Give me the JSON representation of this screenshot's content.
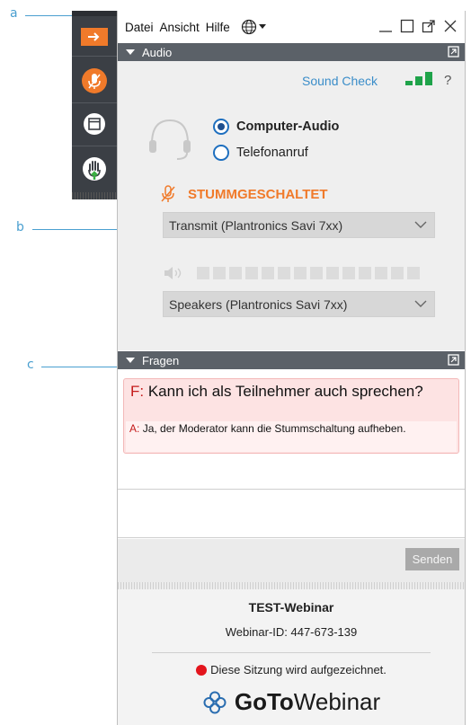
{
  "callouts": [
    "a",
    "b",
    "c"
  ],
  "toolbar": {
    "buttons": [
      {
        "name": "arrow-right-icon",
        "color": "#f07a2a"
      },
      {
        "name": "microphone-muted-icon",
        "color": "#f07a2a"
      },
      {
        "name": "window-icon",
        "color": "#ffffff"
      },
      {
        "name": "raise-hand-icon",
        "color": "#3cb043"
      }
    ]
  },
  "menu": {
    "items": [
      "Datei",
      "Ansicht",
      "Hilfe"
    ]
  },
  "audio": {
    "title": "Audio",
    "sound_check": "Sound Check",
    "help": "?",
    "options": [
      "Computer-Audio",
      "Telefonanruf"
    ],
    "selected_option": "Computer-Audio",
    "muted_label": "STUMMGESCHALTET",
    "microphone_device": "Transmit (Plantronics Savi 7xx)",
    "speaker_device": "Speakers (Plantronics Savi 7xx)",
    "speaker_level": 0,
    "signal_bars": 3
  },
  "questions": {
    "title": "Fragen",
    "question_prefix": "F:",
    "question": "Kann ich als Teilnehmer auch sprechen?",
    "answer_prefix": "A:",
    "answer": "Ja, der Moderator kann die Stummschaltung aufheben.",
    "send_label": "Senden"
  },
  "footer": {
    "webinar_title": "TEST-Webinar",
    "webinar_id": "Webinar-ID: 447-673-139",
    "recording_notice": "Diese Sitzung wird aufgezeichnet.",
    "brand_bold": "GoTo",
    "brand_regular": "Webinar"
  },
  "colors": {
    "accent_orange": "#f07a2a",
    "link_blue": "#3a8dc9",
    "signal_green": "#1fa34a",
    "header_gray": "#5b6168",
    "record_red": "#e3141c"
  }
}
